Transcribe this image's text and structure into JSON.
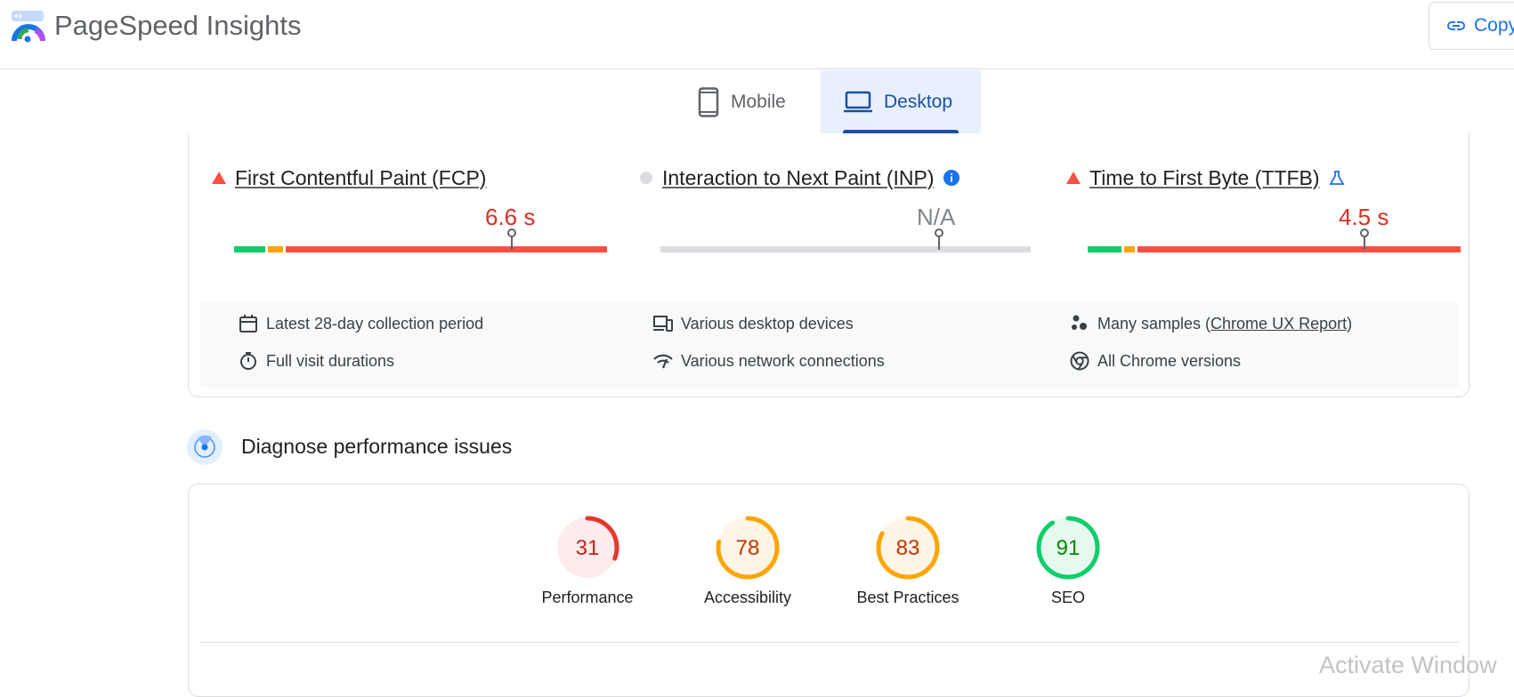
{
  "header": {
    "app_title": "PageSpeed Insights",
    "copy_label": "Copy"
  },
  "tabs": [
    {
      "label": "Mobile",
      "icon": "smartphone-icon",
      "selected": false
    },
    {
      "label": "Desktop",
      "icon": "laptop-icon",
      "selected": true
    }
  ],
  "metrics": [
    {
      "name": "First Contentful Paint (FCP)",
      "value": "6.6 s",
      "status": "poor"
    },
    {
      "name": "Interaction to Next Paint (INP)",
      "value": "N/A",
      "status": "no-data"
    },
    {
      "name": "Time to First Byte (TTFB)",
      "value": "4.5 s",
      "status": "poor"
    }
  ],
  "field_info": {
    "collection_period": "Latest 28-day collection period",
    "devices": "Various desktop devices",
    "samples_prefix": "Many samples (",
    "samples_link": "Chrome UX Report",
    "samples_suffix": ")",
    "visit_durations": "Full visit durations",
    "network": "Various network connections",
    "chrome_versions": "All Chrome versions"
  },
  "diagnose": {
    "title": "Diagnose performance issues"
  },
  "scores": [
    {
      "label": "Performance",
      "value": "31",
      "color": "#e8372d",
      "fill": 0.31
    },
    {
      "label": "Accessibility",
      "value": "78",
      "color": "#ffa400",
      "fill": 0.78
    },
    {
      "label": "Best Practices",
      "value": "83",
      "color": "#ffa400",
      "fill": 0.83
    },
    {
      "label": "SEO",
      "value": "91",
      "color": "#0cce6b",
      "fill": 0.91
    }
  ],
  "colors": {
    "good": "#0cce6b",
    "needs_improvement": "#ffa400",
    "poor": "#ff4e42",
    "accent": "#1a73e8"
  },
  "watermark": "Activate Window"
}
